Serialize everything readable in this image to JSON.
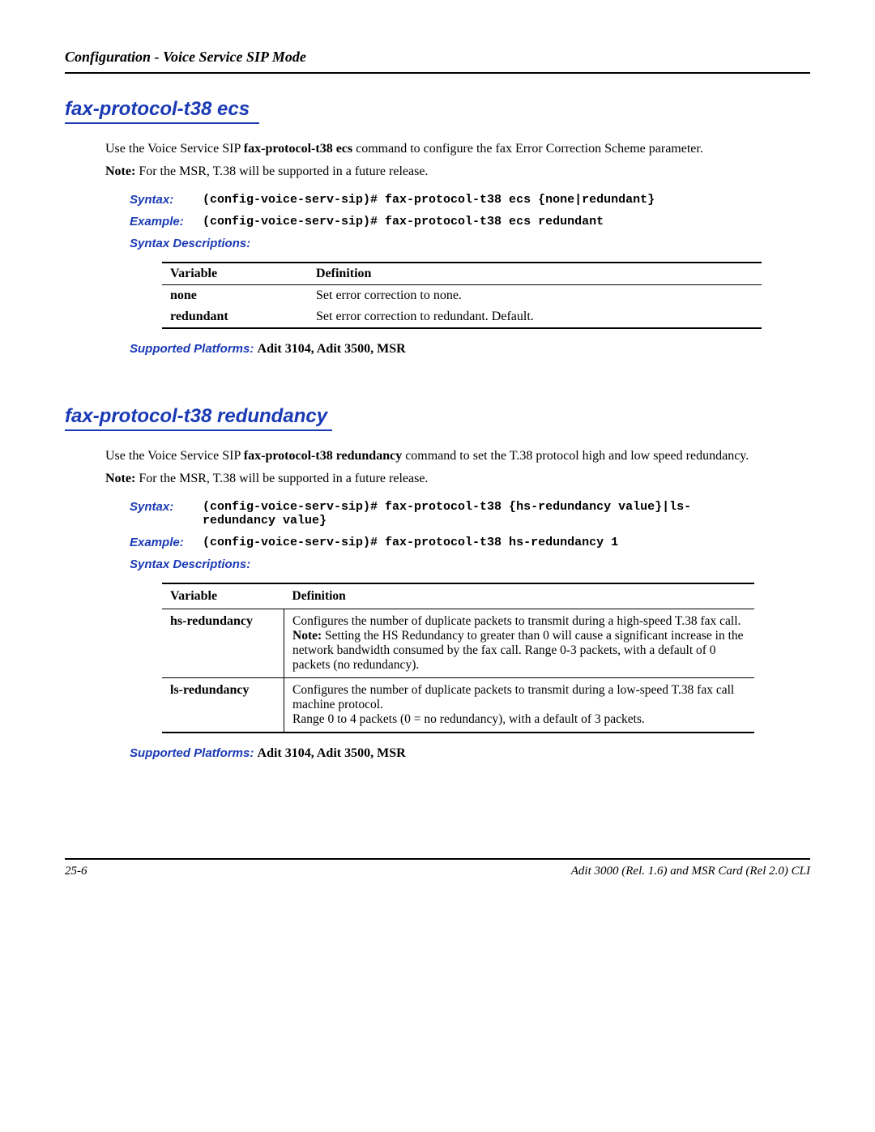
{
  "header": {
    "title": "Configuration - Voice Service SIP Mode"
  },
  "section1": {
    "title": "fax-protocol-t38 ecs",
    "intro_pre": "Use the Voice Service SIP ",
    "intro_cmd": "fax-protocol-t38 ecs",
    "intro_post": " command to configure the fax Error Correction Scheme parameter.",
    "note_label": "Note:",
    "note_text": "  For the MSR, T.38 will be supported in a future release.",
    "syntax_label": "Syntax:",
    "syntax_text": "(config-voice-serv-sip)# fax-protocol-t38 ecs {none|redundant}",
    "example_label": "Example:",
    "example_text": "(config-voice-serv-sip)# fax-protocol-t38 ecs redundant",
    "syntax_desc": "Syntax Descriptions:",
    "table": {
      "head_var": "Variable",
      "head_def": "Definition",
      "rows": [
        {
          "var": "none",
          "def": "Set error correction to none."
        },
        {
          "var": "redundant",
          "def": "Set error correction to redundant. Default."
        }
      ]
    },
    "supported_label": "Supported Platforms:  ",
    "supported_text": "Adit 3104, Adit 3500, MSR"
  },
  "section2": {
    "title": "fax-protocol-t38 redundancy",
    "intro_pre": "Use the Voice Service SIP ",
    "intro_cmd": "fax-protocol-t38 redundancy",
    "intro_post": " command to set the T.38 protocol high and low speed redundancy.",
    "note_label": "Note:",
    "note_text": "  For the MSR, T.38 will be supported in a future release.",
    "syntax_label": "Syntax:",
    "syntax_text": "(config-voice-serv-sip)# fax-protocol-t38 {hs-redundancy value}|ls-redundancy value}",
    "example_label": "Example:",
    "example_text": "(config-voice-serv-sip)# fax-protocol-t38 hs-redundancy 1",
    "syntax_desc": "Syntax Descriptions:",
    "table": {
      "head_var": "Variable",
      "head_def": "Definition",
      "rows": [
        {
          "var": "hs-redundancy",
          "def_pre": "Configures the number of duplicate packets to transmit during a high-speed T.38 fax call.  ",
          "def_bold": "Note:",
          "def_post": " Setting the HS Redundancy to greater than 0 will cause a significant increase in the network bandwidth consumed by the fax call. Range 0-3 packets, with a default of 0 packets (no redundancy)."
        },
        {
          "var": "ls-redundancy",
          "def_pre": "Configures the number of duplicate packets to transmit during a low-speed T.38 fax call machine protocol.\nRange 0 to 4 packets (0 = no redundancy), with a default of 3 packets.",
          "def_bold": "",
          "def_post": ""
        }
      ]
    },
    "supported_label": "Supported Platforms:  ",
    "supported_text": "Adit 3104, Adit 3500, MSR"
  },
  "footer": {
    "left": "25-6",
    "right": "Adit 3000 (Rel. 1.6) and MSR Card (Rel 2.0) CLI"
  }
}
